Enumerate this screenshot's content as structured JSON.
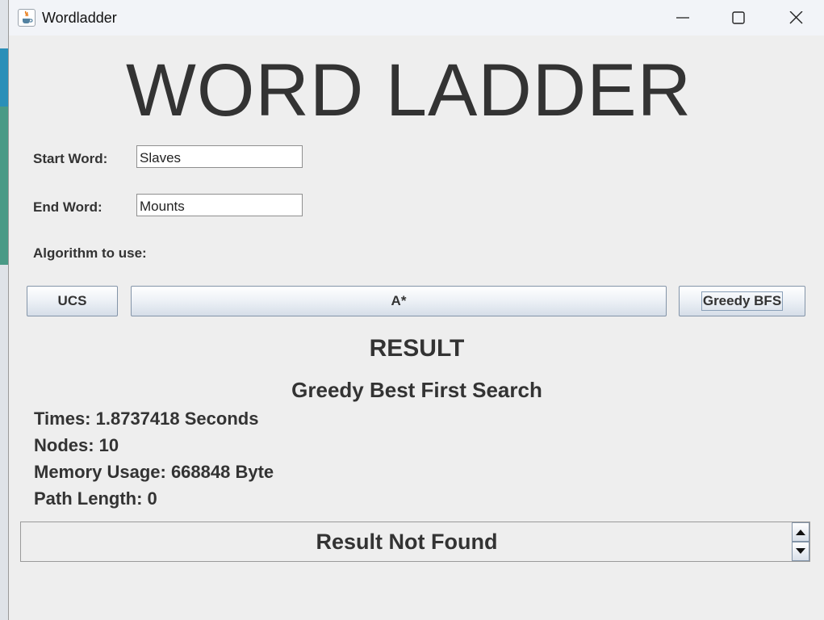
{
  "window": {
    "title": "Wordladder",
    "app_icon": "java-coffee-icon",
    "controls": [
      "minimize-icon",
      "maximize-icon",
      "close-icon"
    ]
  },
  "app": {
    "heading": "WORD LADDER",
    "start_label": "Start Word:",
    "start_value": "Slaves",
    "end_label": "End Word:",
    "end_value": "Mounts",
    "algorithm_label": "Algorithm to use:",
    "buttons": {
      "ucs": "UCS",
      "astar": "A*",
      "greedy": "Greedy BFS"
    }
  },
  "result": {
    "heading": "RESULT",
    "algorithm_name": "Greedy Best First Search",
    "times": "Times: 1.8737418 Seconds",
    "nodes": "Nodes: 10",
    "memory": "Memory Usage: 668848 Byte",
    "path_length": "Path Length: 0",
    "message": "Result Not Found"
  }
}
